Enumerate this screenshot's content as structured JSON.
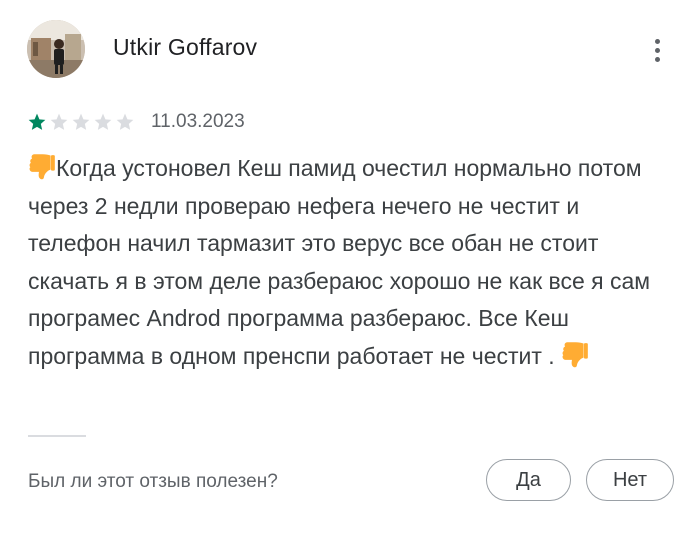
{
  "review": {
    "reviewer_name": "Utkir Goffarov",
    "rating": 1,
    "max_rating": 5,
    "date": "11.03.2023",
    "text_part1": "Когда устоновел Кеш памид очестил нормально потом через 2 недли провераю нефега нечего не честит и телефон начил тармазит это верус все обан не стоит скачать я в этом деле разбераюс хорошо не как все я сам програмес Androd программа разбераюс. Все Кеш программа в одном пренспи работает не честит . ",
    "leading_emoji": "thumbs-down-icon",
    "trailing_emoji": "thumbs-down-icon"
  },
  "helpful": {
    "question": "Был ли этот отзыв полезен?",
    "yes_label": "Да",
    "no_label": "Нет"
  },
  "icons": {
    "menu": "more-vert-icon",
    "star_filled": "star-filled-icon",
    "star_empty": "star-empty-icon"
  },
  "colors": {
    "star_filled": "#01875f",
    "star_empty": "#dadce0",
    "text": "#3c4043",
    "secondary_text": "#5f6368",
    "button_border": "#9aa0a6"
  }
}
